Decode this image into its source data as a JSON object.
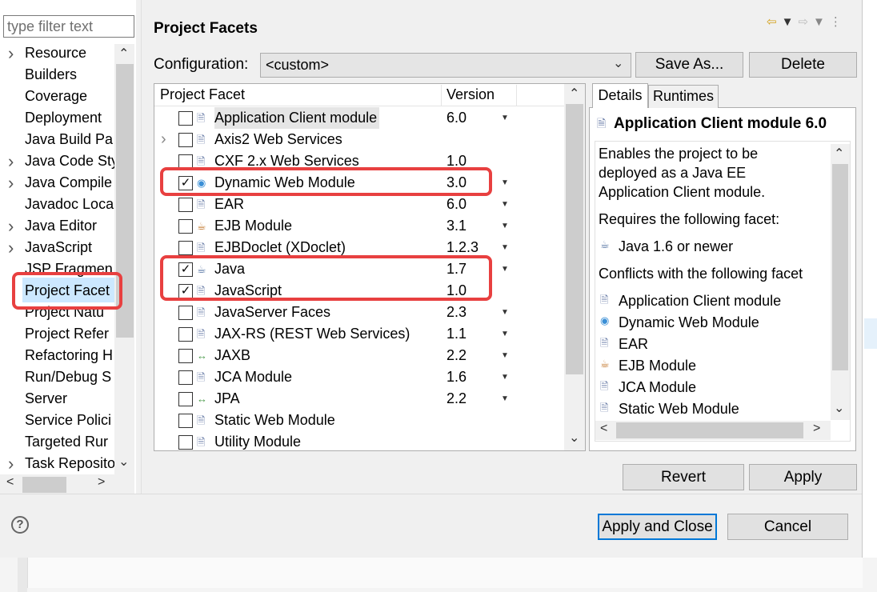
{
  "filter": {
    "placeholder": "type filter text"
  },
  "tree": {
    "items": [
      {
        "label": "Resource",
        "expandable": true
      },
      {
        "label": "Builders",
        "expandable": false
      },
      {
        "label": "Coverage",
        "expandable": false
      },
      {
        "label": "Deployment",
        "expandable": false
      },
      {
        "label": "Java Build Pa",
        "expandable": false
      },
      {
        "label": "Java Code Sty",
        "expandable": true
      },
      {
        "label": "Java Compile",
        "expandable": true
      },
      {
        "label": "Javadoc Loca",
        "expandable": false
      },
      {
        "label": "Java Editor",
        "expandable": true
      },
      {
        "label": "JavaScript",
        "expandable": true
      },
      {
        "label": "JSP Fragmen",
        "expandable": false
      },
      {
        "label": "Project Facet",
        "expandable": false
      },
      {
        "label": "Project Natu",
        "expandable": false
      },
      {
        "label": "Project Refer",
        "expandable": false
      },
      {
        "label": "Refactoring H",
        "expandable": false
      },
      {
        "label": "Run/Debug S",
        "expandable": false
      },
      {
        "label": "Server",
        "expandable": false
      },
      {
        "label": "Service Polici",
        "expandable": false
      },
      {
        "label": "Targeted Rur",
        "expandable": false
      },
      {
        "label": "Task Reposito",
        "expandable": true
      }
    ]
  },
  "header": {
    "title": "Project Facets"
  },
  "config": {
    "label": "Configuration:",
    "value": "<custom>",
    "save_as": "Save As...",
    "delete": "Delete"
  },
  "facets": {
    "col_facet": "Project Facet",
    "col_version": "Version",
    "rows": [
      {
        "name": "Application Client module",
        "version": "6.0",
        "checked": false,
        "dropdown": true,
        "expand": false,
        "icon": "page-icon"
      },
      {
        "name": "Axis2 Web Services",
        "version": "",
        "checked": false,
        "dropdown": false,
        "expand": true,
        "icon": "page-icon"
      },
      {
        "name": "CXF 2.x Web Services",
        "version": "1.0",
        "checked": false,
        "dropdown": false,
        "expand": false,
        "icon": "page-icon"
      },
      {
        "name": "Dynamic Web Module",
        "version": "3.0",
        "checked": true,
        "dropdown": true,
        "expand": false,
        "icon": "globe-icon"
      },
      {
        "name": "EAR",
        "version": "6.0",
        "checked": false,
        "dropdown": true,
        "expand": false,
        "icon": "page-icon"
      },
      {
        "name": "EJB Module",
        "version": "3.1",
        "checked": false,
        "dropdown": true,
        "expand": false,
        "icon": "bean-icon"
      },
      {
        "name": "EJBDoclet (XDoclet)",
        "version": "1.2.3",
        "checked": false,
        "dropdown": true,
        "expand": false,
        "icon": "page-icon"
      },
      {
        "name": "Java",
        "version": "1.7",
        "checked": true,
        "dropdown": true,
        "expand": false,
        "icon": "java-icon"
      },
      {
        "name": "JavaScript",
        "version": "1.0",
        "checked": true,
        "dropdown": false,
        "expand": false,
        "icon": "page-icon"
      },
      {
        "name": "JavaServer Faces",
        "version": "2.3",
        "checked": false,
        "dropdown": true,
        "expand": false,
        "icon": "page-icon"
      },
      {
        "name": "JAX-RS (REST Web Services)",
        "version": "1.1",
        "checked": false,
        "dropdown": true,
        "expand": false,
        "icon": "page-icon"
      },
      {
        "name": "JAXB",
        "version": "2.2",
        "checked": false,
        "dropdown": true,
        "expand": false,
        "icon": "arrows-icon"
      },
      {
        "name": "JCA Module",
        "version": "1.6",
        "checked": false,
        "dropdown": true,
        "expand": false,
        "icon": "page-icon"
      },
      {
        "name": "JPA",
        "version": "2.2",
        "checked": false,
        "dropdown": true,
        "expand": false,
        "icon": "arrows-icon"
      },
      {
        "name": "Static Web Module",
        "version": "",
        "checked": false,
        "dropdown": false,
        "expand": false,
        "icon": "page-icon"
      },
      {
        "name": "Utility Module",
        "version": "",
        "checked": false,
        "dropdown": false,
        "expand": false,
        "icon": "page-icon"
      }
    ]
  },
  "details": {
    "tab_details": "Details",
    "tab_runtimes": "Runtimes",
    "title": "Application Client module 6.0",
    "desc_lines": [
      "Enables the project to be",
      "deployed as a Java EE",
      "Application Client module."
    ],
    "requires_label": "Requires the following facet:",
    "requires": [
      "Java 1.6 or newer"
    ],
    "conflicts_label": "Conflicts with the following facet",
    "conflicts": [
      "Application Client module",
      "Dynamic Web Module",
      "EAR",
      "EJB Module",
      "JCA Module",
      "Static Web Module"
    ]
  },
  "actions": {
    "revert": "Revert",
    "apply": "Apply",
    "apply_close": "Apply and Close",
    "cancel": "Cancel"
  },
  "colors": {
    "highlight": "#e84040",
    "selection": "#cce8ff",
    "focus": "#0078d7"
  }
}
